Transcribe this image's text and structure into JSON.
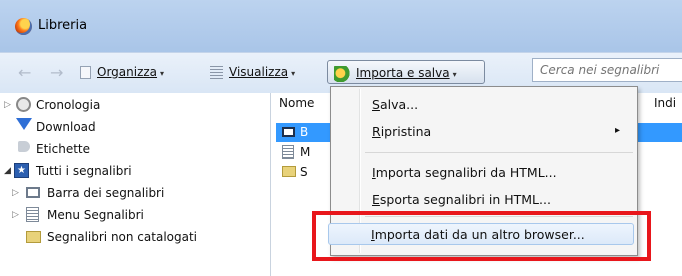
{
  "window": {
    "title": "Libreria"
  },
  "toolbar": {
    "organize_label": "Organizza",
    "view_label": "Visualizza",
    "import_label": "Importa e salva",
    "dropdown_glyph": "▾",
    "back_glyph": "←",
    "forward_glyph": "→"
  },
  "search": {
    "placeholder": "Cerca nei segnalibri"
  },
  "sidebar": {
    "items": [
      {
        "label": "Cronologia",
        "icon": "clock-icon"
      },
      {
        "label": "Download",
        "icon": "download-arrow-icon"
      },
      {
        "label": "Etichette",
        "icon": "tag-icon"
      },
      {
        "label": "Tutti i segnalibri",
        "icon": "bookmarks-star-icon"
      },
      {
        "label": "Barra dei segnalibri",
        "icon": "toolbar-icon"
      },
      {
        "label": "Menu Segnalibri",
        "icon": "menu-list-icon"
      },
      {
        "label": "Segnalibri non catalogati",
        "icon": "unsorted-folder-icon"
      }
    ]
  },
  "content": {
    "columns": [
      "Nome",
      "Indi"
    ],
    "rows": [
      {
        "label": "B",
        "icon": "toolbar-icon",
        "selected": true
      },
      {
        "label": "M",
        "icon": "menu-list-icon"
      },
      {
        "label": "S",
        "icon": "unsorted-folder-icon"
      }
    ]
  },
  "menu": {
    "items": [
      {
        "label": "Salva...",
        "accel": "S",
        "rest": "alva..."
      },
      {
        "label": "Ripristina",
        "accel": "R",
        "rest": "ipristina",
        "submenu_glyph": "▸"
      },
      {
        "label": "Importa segnalibri da HTML...",
        "accel": "I",
        "rest": "mporta segnalibri da HTML..."
      },
      {
        "label": "Esporta segnalibri in HTML...",
        "accel": "E",
        "rest": "sporta segnalibri in HTML..."
      },
      {
        "label": "Importa dati da un altro browser...",
        "accel": "I",
        "rest": "mporta dati da un altro browser...",
        "highlighted": true
      }
    ]
  },
  "colors": {
    "callout": "#e8161b",
    "selection": "#3399ff"
  }
}
